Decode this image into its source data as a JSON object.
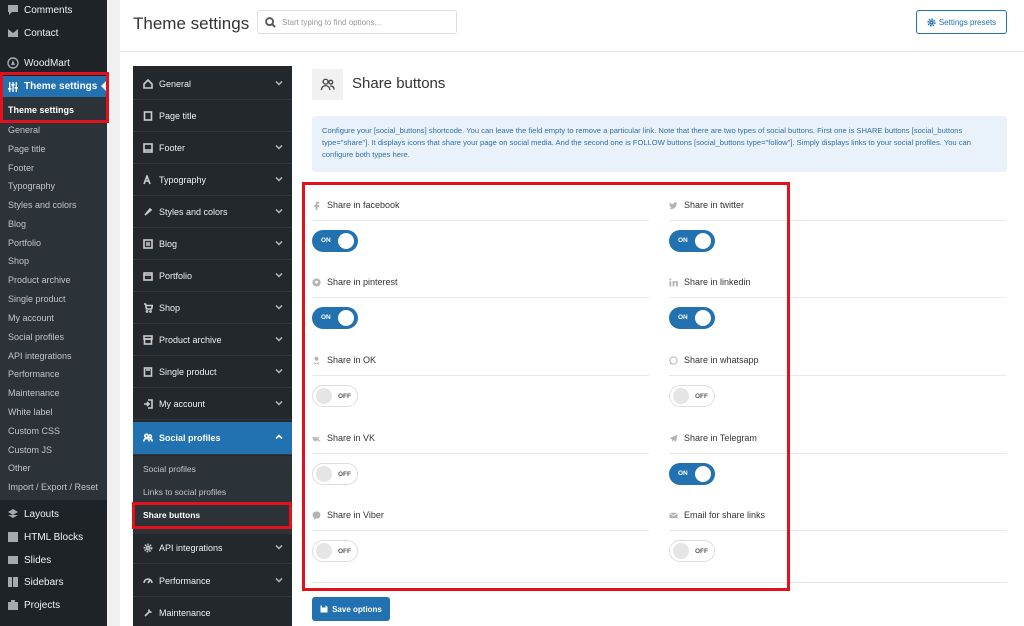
{
  "wp_menu": {
    "items_top": [
      {
        "label": "Comments",
        "icon": "comment-icon"
      },
      {
        "label": "Contact",
        "icon": "mail-icon"
      }
    ],
    "woodmart": {
      "label": "WoodMart",
      "icon": "woodmart-logo-icon"
    },
    "theme_settings": {
      "label": "Theme settings",
      "icon": "sliders-icon"
    },
    "submenu": [
      "Theme settings",
      "General",
      "Page title",
      "Footer",
      "Typography",
      "Styles and colors",
      "Blog",
      "Portfolio",
      "Shop",
      "Product archive",
      "Single product",
      "My account",
      "Social profiles",
      "API integrations",
      "Performance",
      "Maintenance",
      "White label",
      "Custom CSS",
      "Custom JS",
      "Other",
      "Import / Export / Reset"
    ],
    "items_bottom": [
      {
        "label": "Layouts",
        "icon": "layers-icon"
      },
      {
        "label": "HTML Blocks",
        "icon": "html-block-icon"
      },
      {
        "label": "Slides",
        "icon": "slides-icon"
      },
      {
        "label": "Sidebars",
        "icon": "sidebars-icon"
      },
      {
        "label": "Projects",
        "icon": "briefcase-icon"
      }
    ]
  },
  "header": {
    "title": "Theme settings",
    "search_placeholder": "Start typing to find options...",
    "presets_label": "Settings presets"
  },
  "theme_nav": {
    "items": [
      "General",
      "Page title",
      "Footer",
      "Typography",
      "Styles and colors",
      "Blog",
      "Portfolio",
      "Shop",
      "Product archive",
      "Single product",
      "My account",
      "Social profiles",
      "API integrations",
      "Performance",
      "Maintenance"
    ],
    "active": "Social profiles",
    "subitems": [
      "Social profiles",
      "Links to social profiles",
      "Share buttons"
    ],
    "current_sub": "Share buttons"
  },
  "section": {
    "title": "Share buttons",
    "description": "Configure your [social_buttons] shortcode. You can leave the field empty to remove a particular link. Note that there are two types of social buttons. First one is SHARE buttons [social_buttons type=\"share\"]. It displays icons that share your page on social media. And the second one is FOLLOW buttons [social_buttons type=\"follow\"]. Simply displays links to your social profiles. You can configure both types here."
  },
  "fields": [
    {
      "label": "Share in facebook",
      "state": "ON",
      "icon": "facebook-icon"
    },
    {
      "label": "Share in twitter",
      "state": "ON",
      "icon": "twitter-icon"
    },
    {
      "label": "Share in pinterest",
      "state": "ON",
      "icon": "pinterest-icon"
    },
    {
      "label": "Share in linkedin",
      "state": "ON",
      "icon": "linkedin-icon"
    },
    {
      "label": "Share in OK",
      "state": "OFF",
      "icon": "ok-icon"
    },
    {
      "label": "Share in whatsapp",
      "state": "OFF",
      "icon": "whatsapp-icon"
    },
    {
      "label": "Share in VK",
      "state": "OFF",
      "icon": "vk-icon"
    },
    {
      "label": "Share in Telegram",
      "state": "ON",
      "icon": "telegram-icon"
    },
    {
      "label": "Share in Viber",
      "state": "OFF",
      "icon": "viber-icon"
    },
    {
      "label": "Email for share links",
      "state": "OFF",
      "icon": "email-icon"
    }
  ],
  "save_label": "Save options",
  "colors": {
    "accent": "#2271b1",
    "highlight": "#e3111c",
    "wp_dark": "#1d2327"
  }
}
